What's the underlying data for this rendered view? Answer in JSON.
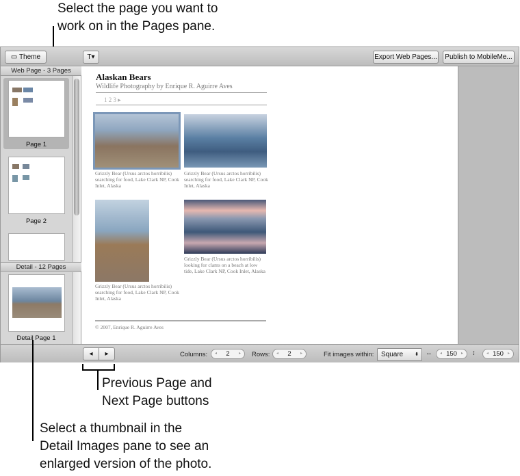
{
  "callouts": {
    "top": [
      "Select the page you want to",
      "work on in the Pages pane."
    ],
    "middle": [
      "Previous Page and",
      "Next Page buttons"
    ],
    "bottom": [
      "Select a thumbnail in the",
      "Detail Images pane to see an",
      "enlarged version of the photo."
    ]
  },
  "toolbar": {
    "theme": "Theme",
    "export": "Export Web Pages...",
    "publish": "Publish to MobileMe..."
  },
  "pages_pane": {
    "header": "Web Page - 3 Pages",
    "items": [
      "Page 1",
      "Page 2"
    ]
  },
  "detail_pane": {
    "header": "Detail - 12 Pages",
    "items": [
      "Detail Page 1"
    ]
  },
  "page": {
    "title": "Alaskan Bears",
    "subtitle": "Wildlife Photography by Enrique R. Aguirre Aves",
    "nav": "1 2 3 ▸",
    "captions": [
      "Grizzly Bear (Ursus arctos horribilis) searching for food, Lake Clark NP, Cook Inlet, Alaska",
      "Grizzly Bear (Ursus arctos horribilis) searching for food, Lake Clark NP, Cook Inlet, Alaska",
      "Grizzly Bear (Ursus arctos horribilis) searching for food, Lake Clark NP, Cook Inlet, Alaska",
      "Grizzly Bear (Ursus arctos horribilis) looking for clams on a beach at low tide, Lake Clark NP, Cook Inlet, Alaska"
    ],
    "footer": "© 2007, Enrique R. Aguirre Aves"
  },
  "bottom": {
    "columns_label": "Columns:",
    "columns": "2",
    "rows_label": "Rows:",
    "rows": "2",
    "fit_label": "Fit images within:",
    "fit": "Square",
    "width": "150",
    "height": "150"
  }
}
